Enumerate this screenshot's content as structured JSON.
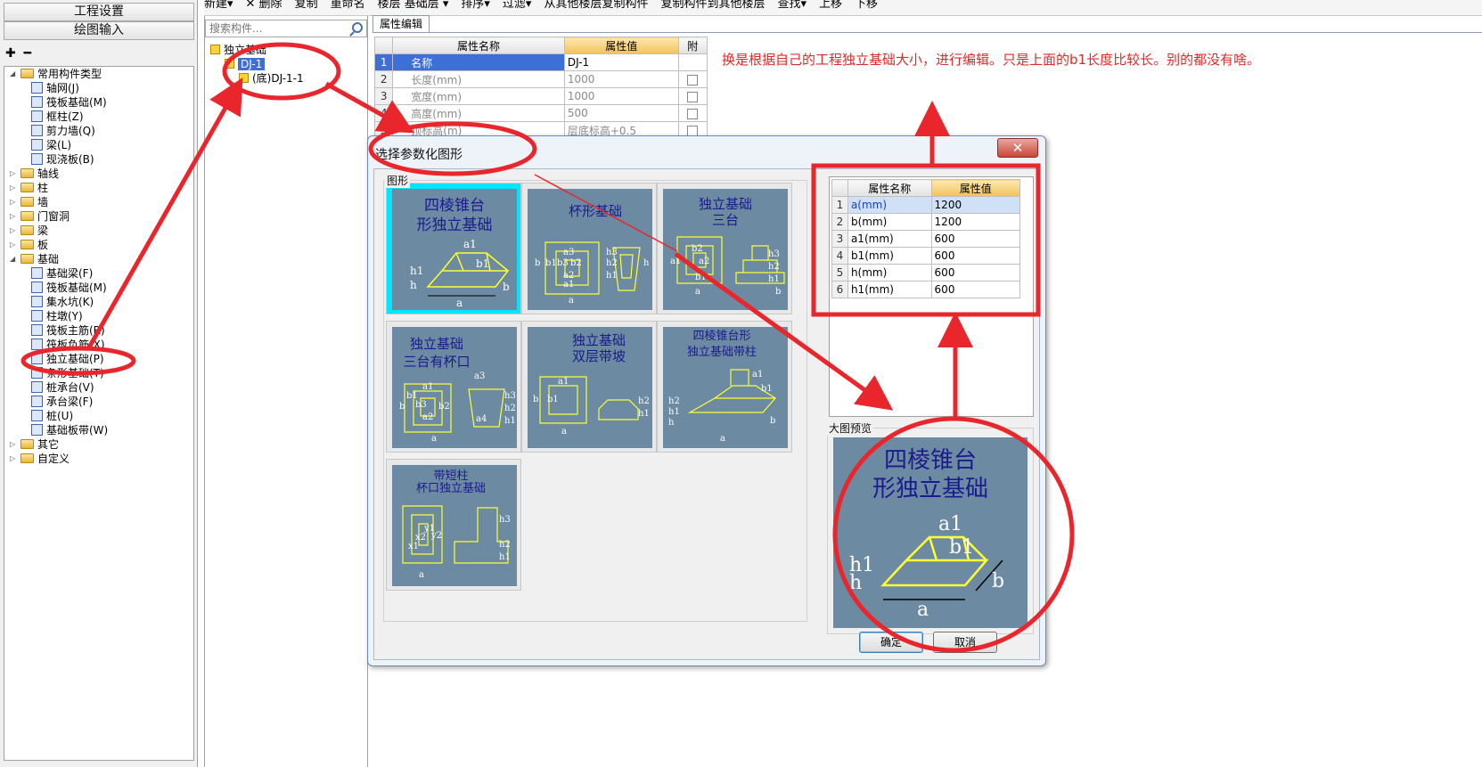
{
  "left": {
    "header1": "工程设置",
    "header2": "绘图输入",
    "tree_tools": "✚ ━",
    "tree": [
      {
        "text": "常用构件类型",
        "level": 0,
        "type": "folder",
        "expanded": true
      },
      {
        "text": "轴网(J)",
        "level": 1,
        "type": "item"
      },
      {
        "text": "筏板基础(M)",
        "level": 1,
        "type": "item"
      },
      {
        "text": "框柱(Z)",
        "level": 1,
        "type": "item"
      },
      {
        "text": "剪力墙(Q)",
        "level": 1,
        "type": "item"
      },
      {
        "text": "梁(L)",
        "level": 1,
        "type": "item"
      },
      {
        "text": "现浇板(B)",
        "level": 1,
        "type": "item"
      },
      {
        "text": "轴线",
        "level": 0,
        "type": "folder"
      },
      {
        "text": "柱",
        "level": 0,
        "type": "folder"
      },
      {
        "text": "墙",
        "level": 0,
        "type": "folder"
      },
      {
        "text": "门窗洞",
        "level": 0,
        "type": "folder"
      },
      {
        "text": "梁",
        "level": 0,
        "type": "folder"
      },
      {
        "text": "板",
        "level": 0,
        "type": "folder"
      },
      {
        "text": "基础",
        "level": 0,
        "type": "folder",
        "expanded": true
      },
      {
        "text": "基础梁(F)",
        "level": 1,
        "type": "item"
      },
      {
        "text": "筏板基础(M)",
        "level": 1,
        "type": "item"
      },
      {
        "text": "集水坑(K)",
        "level": 1,
        "type": "item"
      },
      {
        "text": "柱墩(Y)",
        "level": 1,
        "type": "item"
      },
      {
        "text": "筏板主筋(R)",
        "level": 1,
        "type": "item"
      },
      {
        "text": "筏板负筋(X)",
        "level": 1,
        "type": "item"
      },
      {
        "text": "独立基础(P)",
        "level": 1,
        "type": "item"
      },
      {
        "text": "条形基础(T)",
        "level": 1,
        "type": "item"
      },
      {
        "text": "桩承台(V)",
        "level": 1,
        "type": "item"
      },
      {
        "text": "承台梁(F)",
        "level": 1,
        "type": "item"
      },
      {
        "text": "桩(U)",
        "level": 1,
        "type": "item"
      },
      {
        "text": "基础板带(W)",
        "level": 1,
        "type": "item"
      },
      {
        "text": "其它",
        "level": 0,
        "type": "folder"
      },
      {
        "text": "自定义",
        "level": 0,
        "type": "folder"
      }
    ]
  },
  "toolbar": {
    "items": [
      "新建▾",
      "✕ 删除",
      "复制",
      "重命名",
      "楼层 基础层 ▾",
      "排序▾",
      "过滤▾",
      "从其他楼层复制构件",
      "复制构件到其他楼层",
      "查找▾",
      "上移",
      "下移"
    ]
  },
  "middle": {
    "search_placeholder": "搜索构件...",
    "tree": [
      {
        "text": "独立基础",
        "level": 0
      },
      {
        "text": "DJ-1",
        "level": 1,
        "selected": true
      },
      {
        "text": "(底)DJ-1-1",
        "level": 2
      }
    ]
  },
  "props": {
    "tab": "属性编辑",
    "headers": [
      "属性名称",
      "属性值",
      "附"
    ],
    "rows": [
      {
        "n": "1",
        "name": "名称",
        "value": "DJ-1",
        "check": false
      },
      {
        "n": "2",
        "name": "长度(mm)",
        "value": "1000",
        "check": true
      },
      {
        "n": "3",
        "name": "宽度(mm)",
        "value": "1000",
        "check": true
      },
      {
        "n": "4",
        "name": "高度(mm)",
        "value": "500",
        "check": true
      },
      {
        "n": "5",
        "name": "顶标高(m)",
        "value": "层底标高+0.5",
        "check": true
      }
    ]
  },
  "note": "换是根据自己的工程独立基础大小，进行编辑。只是上面的b1长度比较长。别的都没有啥。",
  "dialog": {
    "title": "选择参数化图形",
    "close": "✕",
    "group_label": "图形",
    "preview_label": "大图预览",
    "ok": "确定",
    "cancel": "取消",
    "shapes": [
      {
        "title1": "四棱锥台",
        "title2": "形独立基础",
        "labels": [
          "a1",
          "b1",
          "h1",
          "h",
          "a",
          "b"
        ]
      },
      {
        "title1": "杯形基础",
        "title2": "",
        "labels": [
          "b",
          "b1",
          "b3",
          "b2",
          "a3",
          "a2",
          "a1",
          "a",
          "h3",
          "h2",
          "h1",
          "h"
        ]
      },
      {
        "title1": "独立基础",
        "title2": "三台",
        "labels": [
          "b2",
          "a2",
          "b1",
          "a1",
          "h3",
          "h2",
          "h1",
          "a",
          "b"
        ]
      },
      {
        "title1": "独立基础",
        "title2": "三台有杯口",
        "labels": [
          "a1",
          "a3",
          "b1",
          "b3",
          "b2",
          "a2",
          "a",
          "b",
          "h3",
          "h2",
          "h1",
          "a4"
        ]
      },
      {
        "title1": "独立基础",
        "title2": "双层带坡",
        "labels": [
          "a1",
          "b1",
          "b",
          "a",
          "h2",
          "h1"
        ]
      },
      {
        "title1": "四棱锥台形",
        "title2": "独立基础带柱",
        "labels": [
          "a1",
          "b1",
          "h2",
          "h1",
          "h",
          "a",
          "b"
        ]
      },
      {
        "title1": "带短柱",
        "title2": "杯口独立基础",
        "labels": [
          "a",
          "x1",
          "x2",
          "y1",
          "y2",
          "h1",
          "h2",
          "h3"
        ]
      }
    ],
    "attr_headers": [
      "属性名称",
      "属性值"
    ],
    "attr_rows": [
      {
        "n": "1",
        "name": "a(mm)",
        "value": "1200"
      },
      {
        "n": "2",
        "name": "b(mm)",
        "value": "1200"
      },
      {
        "n": "3",
        "name": "a1(mm)",
        "value": "600"
      },
      {
        "n": "4",
        "name": "b1(mm)",
        "value": "600"
      },
      {
        "n": "5",
        "name": "h(mm)",
        "value": "600"
      },
      {
        "n": "6",
        "name": "h1(mm)",
        "value": "600"
      }
    ],
    "preview": {
      "title1": "四棱锥台",
      "title2": "形独立基础",
      "labels": [
        "a1",
        "b1",
        "h1",
        "h",
        "a",
        "b"
      ]
    }
  },
  "colors": {
    "annotation": "#e8262b",
    "thumb_bg": "#6c8aa1",
    "thumb_active": "#00e6ff",
    "drawing_yellow": "#ffff33",
    "title_blue": "#1b1b8f",
    "selection": "#3d6fd6"
  }
}
